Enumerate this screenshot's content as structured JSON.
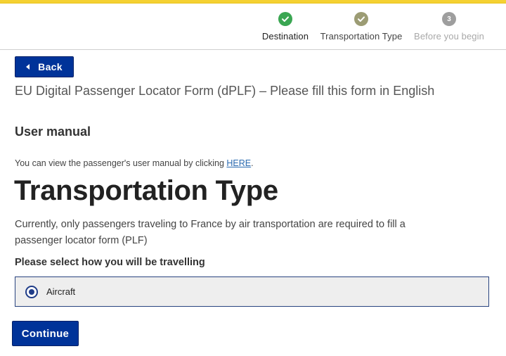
{
  "colors": {
    "accent_bar": "#f5d132",
    "primary_button": "#003399",
    "step_done": "#3aa652",
    "step_current": "#9c9c74",
    "step_pending": "#9e9e9e",
    "link": "#2a6ab0"
  },
  "stepper": {
    "steps": [
      {
        "label": "Destination",
        "state": "completed",
        "icon": "check-icon"
      },
      {
        "label": "Transportation Type",
        "state": "current",
        "icon": "check-icon"
      },
      {
        "label": "Before you begin",
        "state": "pending",
        "number": "3"
      }
    ]
  },
  "nav": {
    "back_label": "Back",
    "back_icon": "caret-left-icon"
  },
  "form_title": "EU Digital Passenger Locator Form (dPLF) – Please fill this form in English",
  "user_manual": {
    "heading": "User manual",
    "text_before": "You can view the passenger's user manual by clicking ",
    "link_text": "HERE",
    "text_after": "."
  },
  "page": {
    "title": "Transportation Type",
    "description": "Currently, only passengers traveling to France by air transportation are required to fill a passenger locator form (PLF)",
    "select_label": "Please select how you will be travelling",
    "options": [
      {
        "label": "Aircraft",
        "selected": true
      }
    ],
    "continue_label": "Continue"
  }
}
